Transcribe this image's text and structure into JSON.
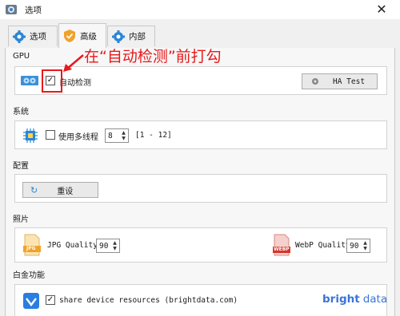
{
  "window": {
    "title": "选项",
    "close_glyph": "✕"
  },
  "tabs": [
    {
      "label": "选项",
      "icon": "gear-icon",
      "active": false
    },
    {
      "label": "高级",
      "icon": "shield-icon",
      "active": true
    },
    {
      "label": "内部",
      "icon": "gear-icon",
      "active": false
    }
  ],
  "gpu": {
    "section_title": "GPU",
    "auto_detect_label": "自动检测",
    "auto_detect_checked": true,
    "ha_test_label": "HA Test"
  },
  "system": {
    "section_title": "系统",
    "multithread_label": "使用多线程",
    "multithread_checked": false,
    "threads_value": "8",
    "range_text": "[1 - 12]"
  },
  "config": {
    "section_title": "配置",
    "reset_label": "重设"
  },
  "photos": {
    "section_title": "照片",
    "jpg_label": "JPG Quality",
    "jpg_value": "90",
    "jpg_icon_text": "JPG",
    "webp_label": "WebP Quality",
    "webp_value": "90",
    "webp_icon_text": "WEBP"
  },
  "platinum": {
    "section_title": "白金功能",
    "share_label": "share device resources (brightdata.com)",
    "share_checked": true,
    "brand_text_a": "bright",
    "brand_text_b": "data"
  },
  "annotation": {
    "text": "在“自动检测”前打勾",
    "color": "#e8191c"
  },
  "colors": {
    "accent_blue": "#2a86d6",
    "tab_orange": "#f0a22a",
    "brand_blue": "#3a74d8"
  }
}
